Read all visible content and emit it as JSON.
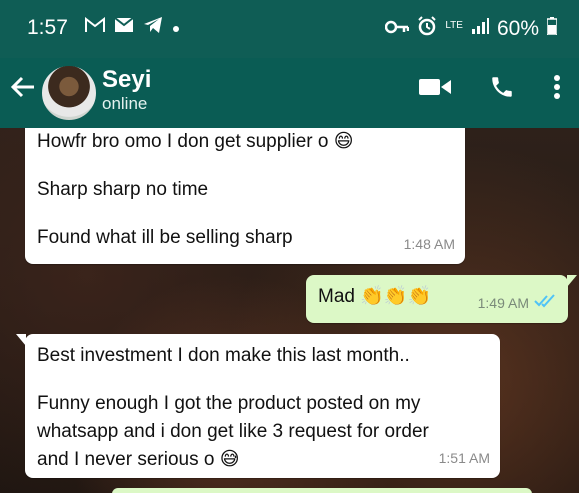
{
  "status_bar": {
    "time": "1:57",
    "network": "LTE",
    "battery": "60%"
  },
  "header": {
    "back_icon": "arrow-left-icon",
    "contact_name": "Seyi",
    "contact_status": "online",
    "video_icon": "video-call-icon",
    "call_icon": "phone-icon",
    "menu_icon": "more-vert-icon"
  },
  "messages": [
    {
      "direction": "incoming",
      "lines": [
        "Howfr bro omo I don get supplier o",
        "Sharp sharp no time",
        "Found what ill be selling sharp"
      ],
      "emoji": "😄",
      "time": "1:48 AM"
    },
    {
      "direction": "outgoing",
      "text": "Mad",
      "emoji": "👏👏👏",
      "time": "1:49 AM",
      "read": true
    },
    {
      "direction": "incoming",
      "lines": [
        "Best investment I don make this last month..",
        "Funny enough I got the product posted on my",
        "whatsapp and i don get like 3 request for order",
        "and I never serious o"
      ],
      "emoji": "😅",
      "time": "1:51 AM"
    }
  ],
  "colors": {
    "header": "#0a5c54",
    "outgoing_bubble": "#dcf8c6",
    "read_ticks": "#4fc3f7"
  }
}
